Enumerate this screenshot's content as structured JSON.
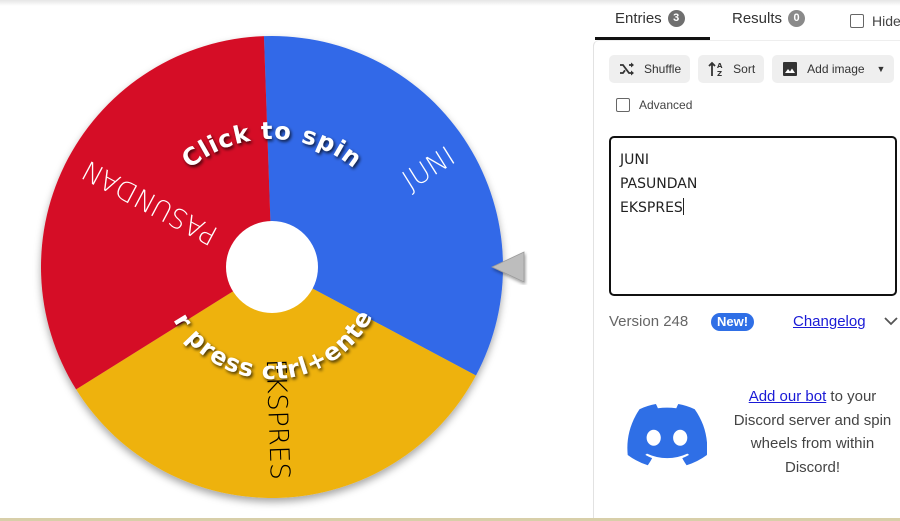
{
  "wheel": {
    "segments": [
      {
        "label": "JUNI",
        "color": "#3369e8",
        "text_color": "#ffffff"
      },
      {
        "label": "EKSPRES",
        "color": "#eeb211",
        "text_color": "#000000"
      },
      {
        "label": "PASUNDAN",
        "color": "#d50f25",
        "text_color": "#ffffff"
      }
    ],
    "hub_color": "#ffffff",
    "pointer_color": "#bdbdbd",
    "spin_prompt_top": "Click to spin",
    "spin_prompt_bottom": "or press ctrl+enter"
  },
  "tabs": [
    {
      "label": "Entries",
      "count": "3",
      "active": true
    },
    {
      "label": "Results",
      "count": "0",
      "active": false
    }
  ],
  "hide_label": "Hide",
  "toolbar": {
    "shuffle_label": "Shuffle",
    "sort_label": "Sort",
    "add_image_label": "Add image"
  },
  "advanced_label": "Advanced",
  "entries_text": "JUNI\nPASUNDAN\nEKSPRES",
  "version": {
    "text": "Version 248",
    "badge": "New!",
    "changelog_label": "Changelog"
  },
  "discord": {
    "link_text": "Add our bot",
    "rest_text": " to your Discord server and spin wheels from within Discord!",
    "logo_color": "#2f6fe6"
  }
}
